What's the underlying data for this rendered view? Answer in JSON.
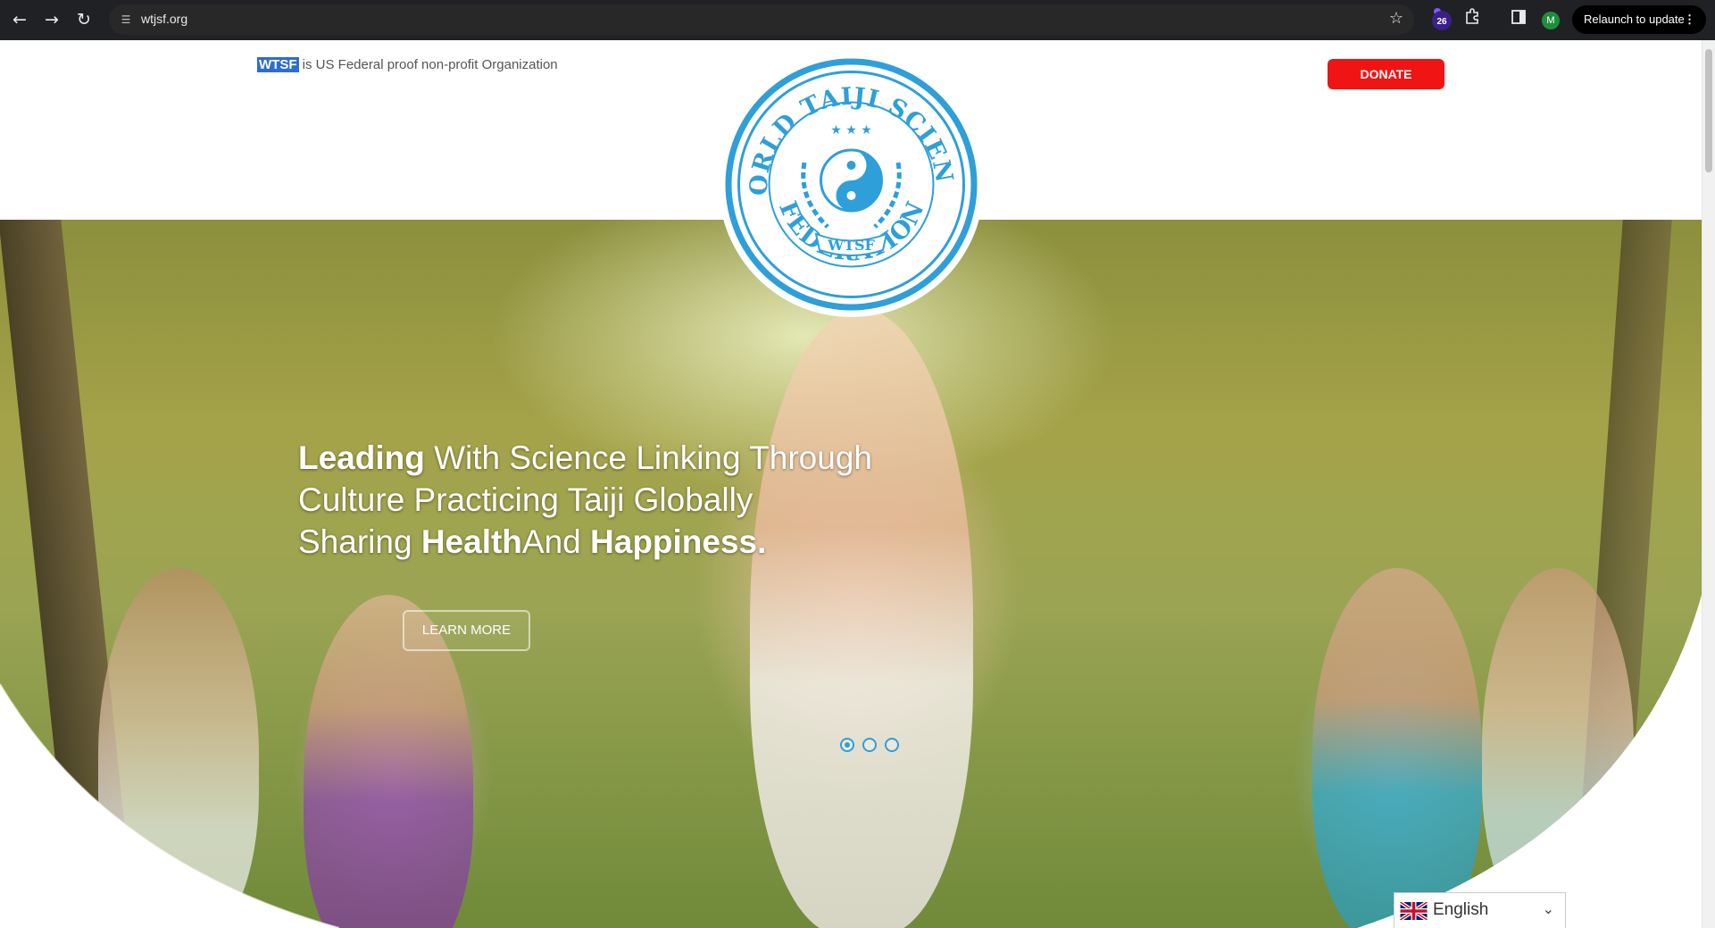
{
  "browser": {
    "url": "wtjsf.org",
    "extension_badge": "26",
    "profile_initial": "M",
    "relaunch_label": "Relaunch to update",
    "icons": [
      "back-arrow-icon",
      "forward-arrow-icon",
      "reload-icon",
      "site-info-icon",
      "bookmark-star-icon",
      "extensions-puzzle-icon",
      "side-panel-icon",
      "menu-dots-icon"
    ]
  },
  "page": {
    "org_abbr": "WTSF",
    "org_note": " is US Federal proof non-profit Organization",
    "donate_label": "DONATE",
    "logo": {
      "top_text": "WORLD TAIJI SCIENCE",
      "middle_text": "WTSF",
      "bottom_text": "FEDERATION"
    },
    "hero": {
      "headline_1_bold": "Leading",
      "headline_1_rest": " With Science Linking Through",
      "headline_2": "Culture Practicing Taiji Globally",
      "headline_3_pre": "Sharing ",
      "headline_3_bold1": "Health",
      "headline_3_mid": "And ",
      "headline_3_bold2": "Happiness.",
      "learn_more_label": "LEARN MORE",
      "slide_count": 3,
      "active_slide": 1
    },
    "language": {
      "selected": "English"
    }
  },
  "colors": {
    "accent_blue": "#2e9fd9",
    "donate_red": "#f01414",
    "highlight_blue": "#2e6cd1"
  }
}
